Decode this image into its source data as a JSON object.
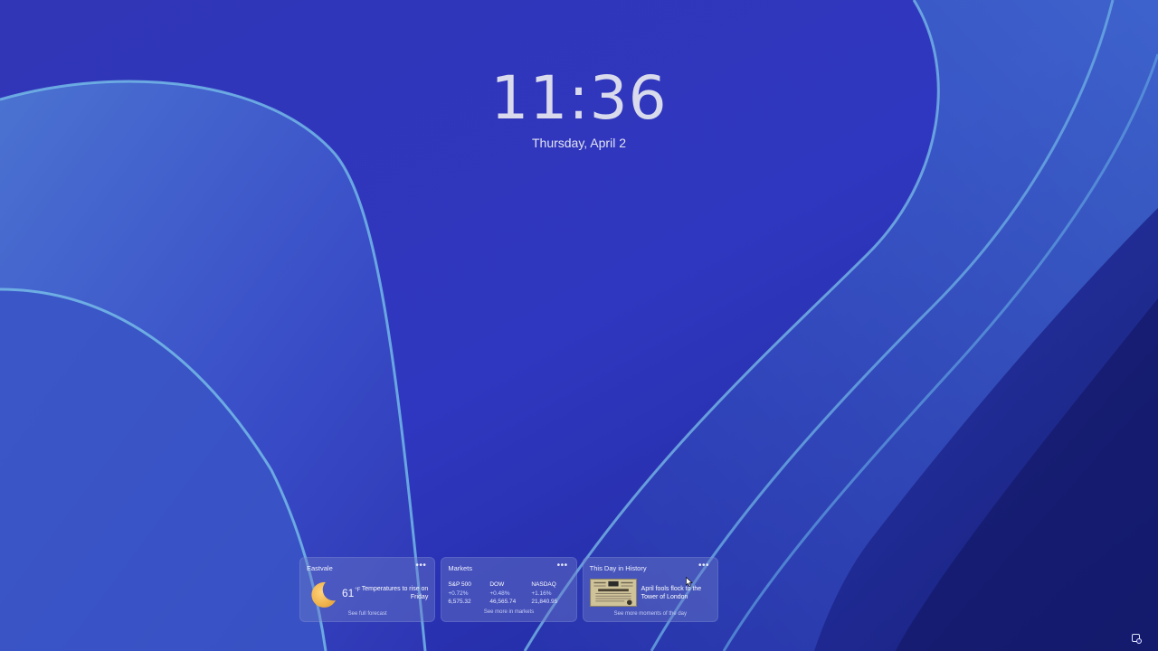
{
  "lockscreen": {
    "time": "11:36",
    "date": "Thursday, April 2"
  },
  "widgets": {
    "weather": {
      "title": "Eastvale",
      "temperature": "61",
      "unit": "°F",
      "condition_icon": "moon-icon",
      "description": "Temperatures to rise on Friday",
      "link": "See full forecast"
    },
    "markets": {
      "title": "Markets",
      "indices": [
        {
          "name": "S&P 500",
          "change": "+0.72%",
          "value": "6,575.32"
        },
        {
          "name": "DOW",
          "change": "+0.48%",
          "value": "46,565.74"
        },
        {
          "name": "NASDAQ",
          "change": "+1.16%",
          "value": "21,840.95"
        }
      ],
      "link": "See more in markets"
    },
    "history": {
      "title": "This Day in History",
      "headline": "April fools flock to the Tower of London",
      "link": "See more moments of the day"
    },
    "more_icon": "more-icon"
  },
  "colors": {
    "wallpaper_base": "#2f33b8",
    "widget_bg": "#6e7dc8"
  }
}
